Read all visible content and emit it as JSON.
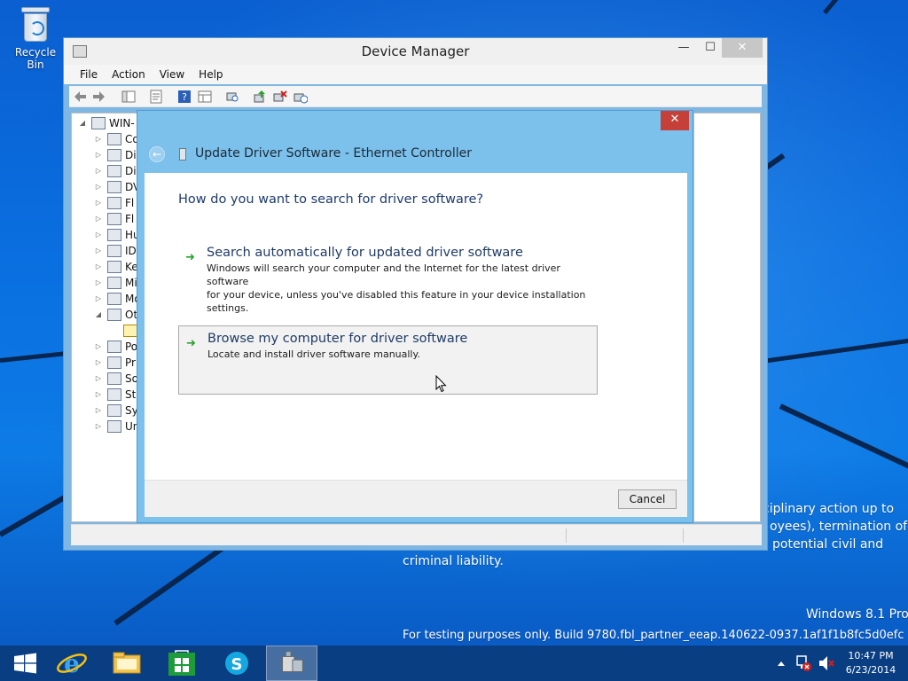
{
  "desktop": {
    "icons": [
      {
        "label": "Recycle Bin",
        "icon": "recycle-bin-icon"
      }
    ],
    "watermark": {
      "legal_line1": "ciplinary action up to",
      "legal_line2": "oyees), termination of",
      "legal_line3": "potential civil and",
      "legal_line4": "criminal liability.",
      "edition": "Windows 8.1 Pro",
      "build": "For testing purposes only. Build 9780.fbl_partner_eeap.140622-0937.1af1f1b8fc5d0efc"
    }
  },
  "device_manager": {
    "title": "Device Manager",
    "menus": [
      "File",
      "Action",
      "View",
      "Help"
    ],
    "tree_root": "WIN-",
    "tree_items": [
      "Co",
      "Di",
      "Di",
      "DV",
      "Fl",
      "Fl",
      "Hu",
      "ID",
      "Ke",
      "Mi",
      "Mo",
      "Ot",
      "",
      "Po",
      "Pr",
      "So",
      "St",
      "Sy",
      "Un"
    ]
  },
  "wizard": {
    "title": "Update Driver Software - Ethernet Controller",
    "question": "How do you want to search for driver software?",
    "option_auto": {
      "title": "Search automatically for updated driver software",
      "desc_line1": "Windows will search your computer and the Internet for the latest driver software",
      "desc_line2": "for your device, unless you've disabled this feature in your device installation",
      "desc_line3": "settings."
    },
    "option_browse": {
      "title": "Browse my computer for driver software",
      "desc": "Locate and install driver software manually."
    },
    "cancel_label": "Cancel",
    "close_glyph": "✕",
    "back_glyph": "←",
    "arrow_glyph": "➜"
  },
  "taskbar": {
    "apps": [
      "start-icon",
      "internet-explorer-icon",
      "file-explorer-icon",
      "store-icon",
      "skype-icon",
      "device-manager-icon"
    ],
    "time": "10:47 PM",
    "date": "6/23/2014",
    "accent": "#0a3e82"
  }
}
